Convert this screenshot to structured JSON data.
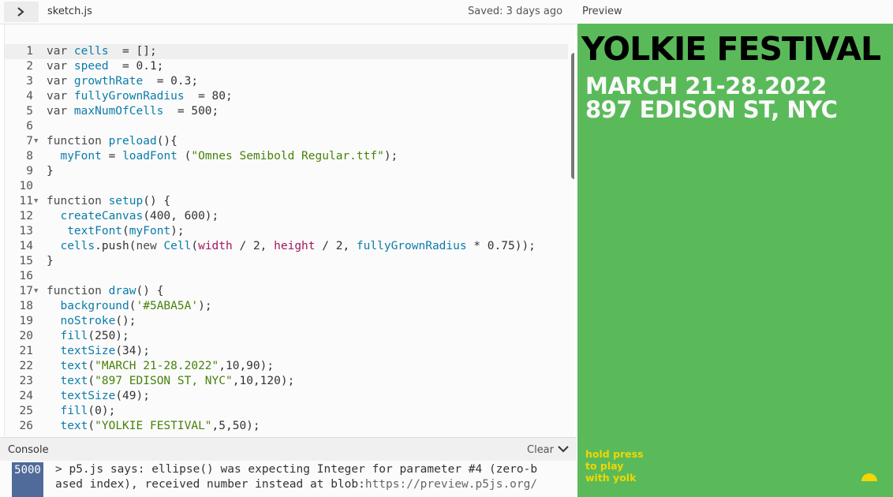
{
  "header": {
    "file_name": "sketch.js",
    "saved_status": "Saved: 3 days ago",
    "preview_label": "Preview"
  },
  "editor": {
    "lines": [
      {
        "n": "1",
        "fold": ""
      },
      {
        "n": "2",
        "fold": ""
      },
      {
        "n": "3",
        "fold": ""
      },
      {
        "n": "4",
        "fold": ""
      },
      {
        "n": "5",
        "fold": ""
      },
      {
        "n": "6",
        "fold": ""
      },
      {
        "n": "7",
        "fold": "▼"
      },
      {
        "n": "8",
        "fold": ""
      },
      {
        "n": "9",
        "fold": ""
      },
      {
        "n": "10",
        "fold": ""
      },
      {
        "n": "11",
        "fold": "▼"
      },
      {
        "n": "12",
        "fold": ""
      },
      {
        "n": "13",
        "fold": ""
      },
      {
        "n": "14",
        "fold": ""
      },
      {
        "n": "15",
        "fold": ""
      },
      {
        "n": "16",
        "fold": ""
      },
      {
        "n": "17",
        "fold": "▼"
      },
      {
        "n": "18",
        "fold": ""
      },
      {
        "n": "19",
        "fold": ""
      },
      {
        "n": "20",
        "fold": ""
      },
      {
        "n": "21",
        "fold": ""
      },
      {
        "n": "22",
        "fold": ""
      },
      {
        "n": "23",
        "fold": ""
      },
      {
        "n": "24",
        "fold": ""
      },
      {
        "n": "25",
        "fold": ""
      },
      {
        "n": "26",
        "fold": ""
      }
    ],
    "tokens": [
      [
        [
          "kw",
          "var "
        ],
        [
          "var",
          "cells"
        ],
        [
          "",
          "  = [];"
        ]
      ],
      [
        [
          "kw",
          "var "
        ],
        [
          "var",
          "speed"
        ],
        [
          "",
          "  = 0.1;"
        ]
      ],
      [
        [
          "kw",
          "var "
        ],
        [
          "var",
          "growthRate"
        ],
        [
          "",
          "  = 0.3;"
        ]
      ],
      [
        [
          "kw",
          "var "
        ],
        [
          "var",
          "fullyGrownRadius"
        ],
        [
          "",
          "  = 80;"
        ]
      ],
      [
        [
          "kw",
          "var "
        ],
        [
          "var",
          "maxNumOfCells"
        ],
        [
          "",
          "  = 500;"
        ]
      ],
      [],
      [
        [
          "kw",
          "function "
        ],
        [
          "fn",
          "preload"
        ],
        [
          "",
          "(){"
        ]
      ],
      [
        [
          "",
          "  "
        ],
        [
          "var",
          "myFont"
        ],
        [
          "",
          " = "
        ],
        [
          "fn",
          "loadFont"
        ],
        [
          "",
          " ("
        ],
        [
          "str",
          "\"Omnes Semibold Regular.ttf\""
        ],
        [
          "",
          ");"
        ]
      ],
      [
        [
          "",
          "}"
        ]
      ],
      [],
      [
        [
          "kw",
          "function "
        ],
        [
          "fn",
          "setup"
        ],
        [
          "",
          "() {"
        ]
      ],
      [
        [
          "",
          "  "
        ],
        [
          "fn",
          "createCanvas"
        ],
        [
          "",
          "(400, 600);"
        ]
      ],
      [
        [
          "",
          "   "
        ],
        [
          "fn",
          "textFont"
        ],
        [
          "",
          "("
        ],
        [
          "var",
          "myFont"
        ],
        [
          "",
          ");"
        ]
      ],
      [
        [
          "",
          "  "
        ],
        [
          "var",
          "cells"
        ],
        [
          "",
          ".push("
        ],
        [
          "kw",
          "new "
        ],
        [
          "fn",
          "Cell"
        ],
        [
          "",
          "("
        ],
        [
          "prop",
          "width"
        ],
        [
          "",
          " / 2, "
        ],
        [
          "prop",
          "height"
        ],
        [
          "",
          " / 2, "
        ],
        [
          "var",
          "fullyGrownRadius"
        ],
        [
          "",
          " * 0.75));"
        ]
      ],
      [
        [
          "",
          "}"
        ]
      ],
      [],
      [
        [
          "kw",
          "function "
        ],
        [
          "fn",
          "draw"
        ],
        [
          "",
          "() {"
        ]
      ],
      [
        [
          "",
          "  "
        ],
        [
          "fn",
          "background"
        ],
        [
          "",
          "("
        ],
        [
          "str",
          "'#5ABA5A'"
        ],
        [
          "",
          ");"
        ]
      ],
      [
        [
          "",
          "  "
        ],
        [
          "fn",
          "noStroke"
        ],
        [
          "",
          "();"
        ]
      ],
      [
        [
          "",
          "  "
        ],
        [
          "fn",
          "fill"
        ],
        [
          "",
          "(250);"
        ]
      ],
      [
        [
          "",
          "  "
        ],
        [
          "fn",
          "textSize"
        ],
        [
          "",
          "(34);"
        ]
      ],
      [
        [
          "",
          "  "
        ],
        [
          "fn",
          "text"
        ],
        [
          "",
          "("
        ],
        [
          "str",
          "\"MARCH 21-28.2022\""
        ],
        [
          "",
          ",10,90);"
        ]
      ],
      [
        [
          "",
          "  "
        ],
        [
          "fn",
          "text"
        ],
        [
          "",
          "("
        ],
        [
          "str",
          "\"897 EDISON ST, NYC\""
        ],
        [
          "",
          ",10,120);"
        ]
      ],
      [
        [
          "",
          "  "
        ],
        [
          "fn",
          "textSize"
        ],
        [
          "",
          "(49);"
        ]
      ],
      [
        [
          "",
          "  "
        ],
        [
          "fn",
          "fill"
        ],
        [
          "",
          "(0);"
        ]
      ],
      [
        [
          "",
          "  "
        ],
        [
          "fn",
          "text"
        ],
        [
          "",
          "("
        ],
        [
          "str",
          "\"YOLKIE FESTIVAL\""
        ],
        [
          "",
          ",5,50);"
        ]
      ]
    ]
  },
  "console": {
    "title": "Console",
    "clear_label": "Clear",
    "count": "5000",
    "message_line1": "> p5.js says: ellipse() was expecting Integer for parameter #4 (zero-b",
    "message_line2a": "ased index), received number instead at blob:",
    "message_line2b": "https://preview.p5js.org/"
  },
  "preview": {
    "title": "YOLKIE FESTIVAL",
    "date": "MARCH 21-28.2022",
    "address": "897 EDISON ST, NYC",
    "hint_line1": "hold press",
    "hint_line2": "to play",
    "hint_line3": "with yolk",
    "background_color": "#5ABA5A",
    "accent_color": "#F2D600"
  }
}
